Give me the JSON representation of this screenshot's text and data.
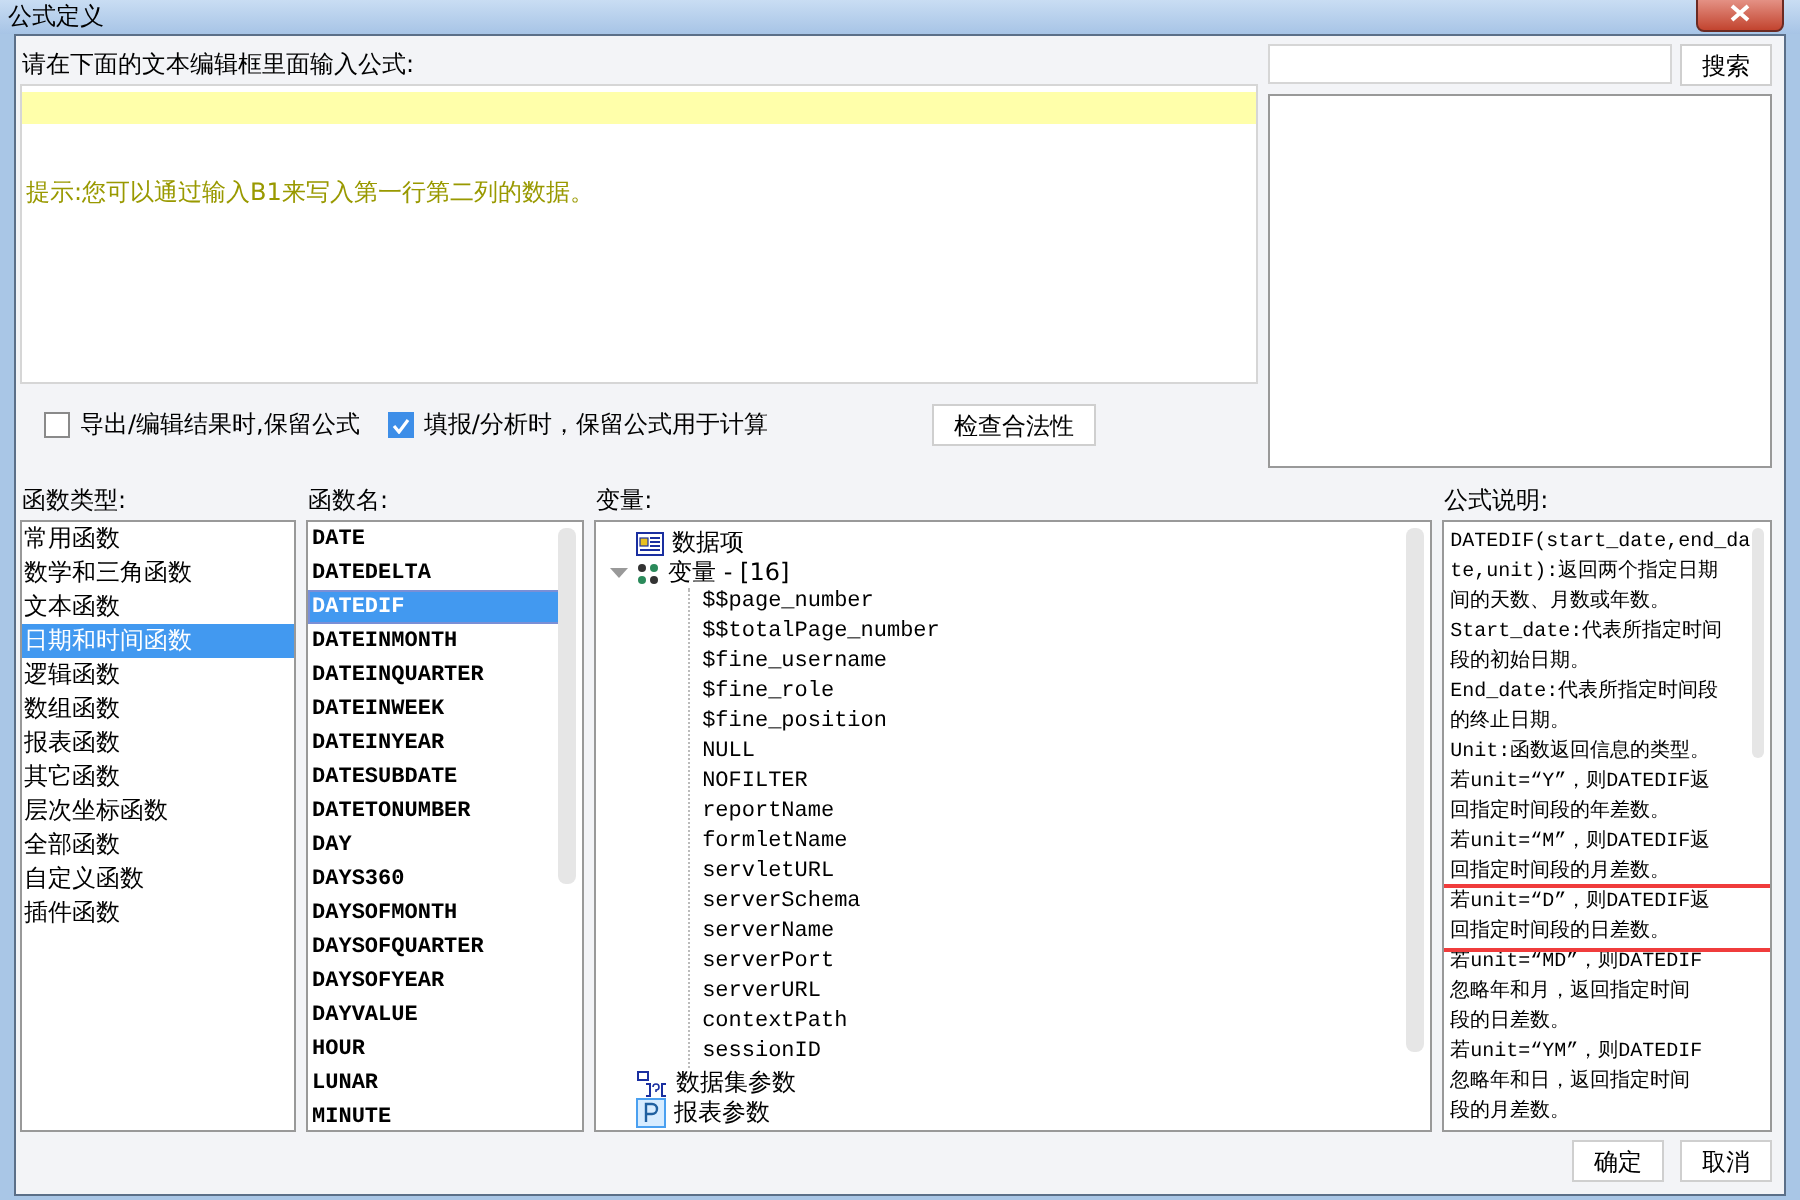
{
  "window": {
    "title": "公式定义"
  },
  "editor": {
    "label": "请在下面的文本编辑框里面输入公式:",
    "hint": "提示:您可以通过输入B1来写入第一行第二列的数据。"
  },
  "search": {
    "button": "搜索"
  },
  "options": [
    {
      "label": "导出/编辑结果时,保留公式",
      "checked": false
    },
    {
      "label": "填报/分析时，保留公式用于计算",
      "checked": true
    }
  ],
  "check_button": "检查合法性",
  "function_types": {
    "label": "函数类型:",
    "items": [
      {
        "label": "常用函数",
        "selected": false
      },
      {
        "label": "数学和三角函数",
        "selected": false
      },
      {
        "label": "文本函数",
        "selected": false
      },
      {
        "label": "日期和时间函数",
        "selected": true
      },
      {
        "label": "逻辑函数",
        "selected": false
      },
      {
        "label": "数组函数",
        "selected": false
      },
      {
        "label": "报表函数",
        "selected": false
      },
      {
        "label": "其它函数",
        "selected": false
      },
      {
        "label": "层次坐标函数",
        "selected": false
      },
      {
        "label": "全部函数",
        "selected": false
      },
      {
        "label": "自定义函数",
        "selected": false
      },
      {
        "label": "插件函数",
        "selected": false
      }
    ]
  },
  "function_names": {
    "label": "函数名:",
    "items": [
      {
        "label": "DATE",
        "selected": false
      },
      {
        "label": "DATEDELTA",
        "selected": false
      },
      {
        "label": "DATEDIF",
        "selected": true
      },
      {
        "label": "DATEINMONTH",
        "selected": false
      },
      {
        "label": "DATEINQUARTER",
        "selected": false
      },
      {
        "label": "DATEINWEEK",
        "selected": false
      },
      {
        "label": "DATEINYEAR",
        "selected": false
      },
      {
        "label": "DATESUBDATE",
        "selected": false
      },
      {
        "label": "DATETONUMBER",
        "selected": false
      },
      {
        "label": "DAY",
        "selected": false
      },
      {
        "label": "DAYS360",
        "selected": false
      },
      {
        "label": "DAYSOFMONTH",
        "selected": false
      },
      {
        "label": "DAYSOFQUARTER",
        "selected": false
      },
      {
        "label": "DAYSOFYEAR",
        "selected": false
      },
      {
        "label": "DAYVALUE",
        "selected": false
      },
      {
        "label": "HOUR",
        "selected": false
      },
      {
        "label": "LUNAR",
        "selected": false
      },
      {
        "label": "MINUTE",
        "selected": false
      }
    ]
  },
  "variables": {
    "label": "变量:",
    "items": [
      {
        "label": "数据项",
        "kind": "data-item"
      },
      {
        "label": "变量 - [16]",
        "kind": "variable-group",
        "expanded": true,
        "children": [
          {
            "label": "$$page_number"
          },
          {
            "label": "$$totalPage_number"
          },
          {
            "label": "$fine_username"
          },
          {
            "label": "$fine_role"
          },
          {
            "label": "$fine_position"
          },
          {
            "label": "NULL"
          },
          {
            "label": "NOFILTER"
          },
          {
            "label": "reportName"
          },
          {
            "label": "formletName"
          },
          {
            "label": "servletURL"
          },
          {
            "label": "serverSchema"
          },
          {
            "label": "serverName"
          },
          {
            "label": "serverPort"
          },
          {
            "label": "serverURL"
          },
          {
            "label": "contextPath"
          },
          {
            "label": "sessionID"
          }
        ]
      },
      {
        "label": "数据集参数",
        "kind": "dataset-param"
      },
      {
        "label": "报表参数",
        "kind": "report-param"
      }
    ]
  },
  "description": {
    "label": "公式说明:",
    "paragraphs": [
      {
        "lines": [
          "DATEDIF(start_date,end_da",
          "te,unit):返回两个指定日期",
          "间的天数、月数或年数。"
        ],
        "highlighted": false
      },
      {
        "lines": [
          "Start_date:代表所指定时间",
          "段的初始日期。"
        ],
        "highlighted": false
      },
      {
        "lines": [
          "End_date:代表所指定时间段",
          "的终止日期。"
        ],
        "highlighted": false
      },
      {
        "lines": [
          "Unit:函数返回信息的类型。"
        ],
        "highlighted": false
      },
      {
        "lines": [
          "若unit=“Y”，则DATEDIF返",
          "回指定时间段的年差数。"
        ],
        "highlighted": false
      },
      {
        "lines": [
          "若unit=“M”，则DATEDIF返",
          "回指定时间段的月差数。"
        ],
        "highlighted": false
      },
      {
        "lines": [
          "若unit=“D”，则DATEDIF返",
          "回指定时间段的日差数。"
        ],
        "highlighted": true
      },
      {
        "lines": [
          "若unit=“MD”，则DATEDIF",
          "忽略年和月，返回指定时间",
          "段的日差数。"
        ],
        "highlighted": false
      },
      {
        "lines": [
          "若unit=“YM”，则DATEDIF",
          "忽略年和日，返回指定时间",
          "段的月差数。"
        ],
        "highlighted": false
      }
    ]
  },
  "buttons": [
    "确定",
    "取消"
  ]
}
